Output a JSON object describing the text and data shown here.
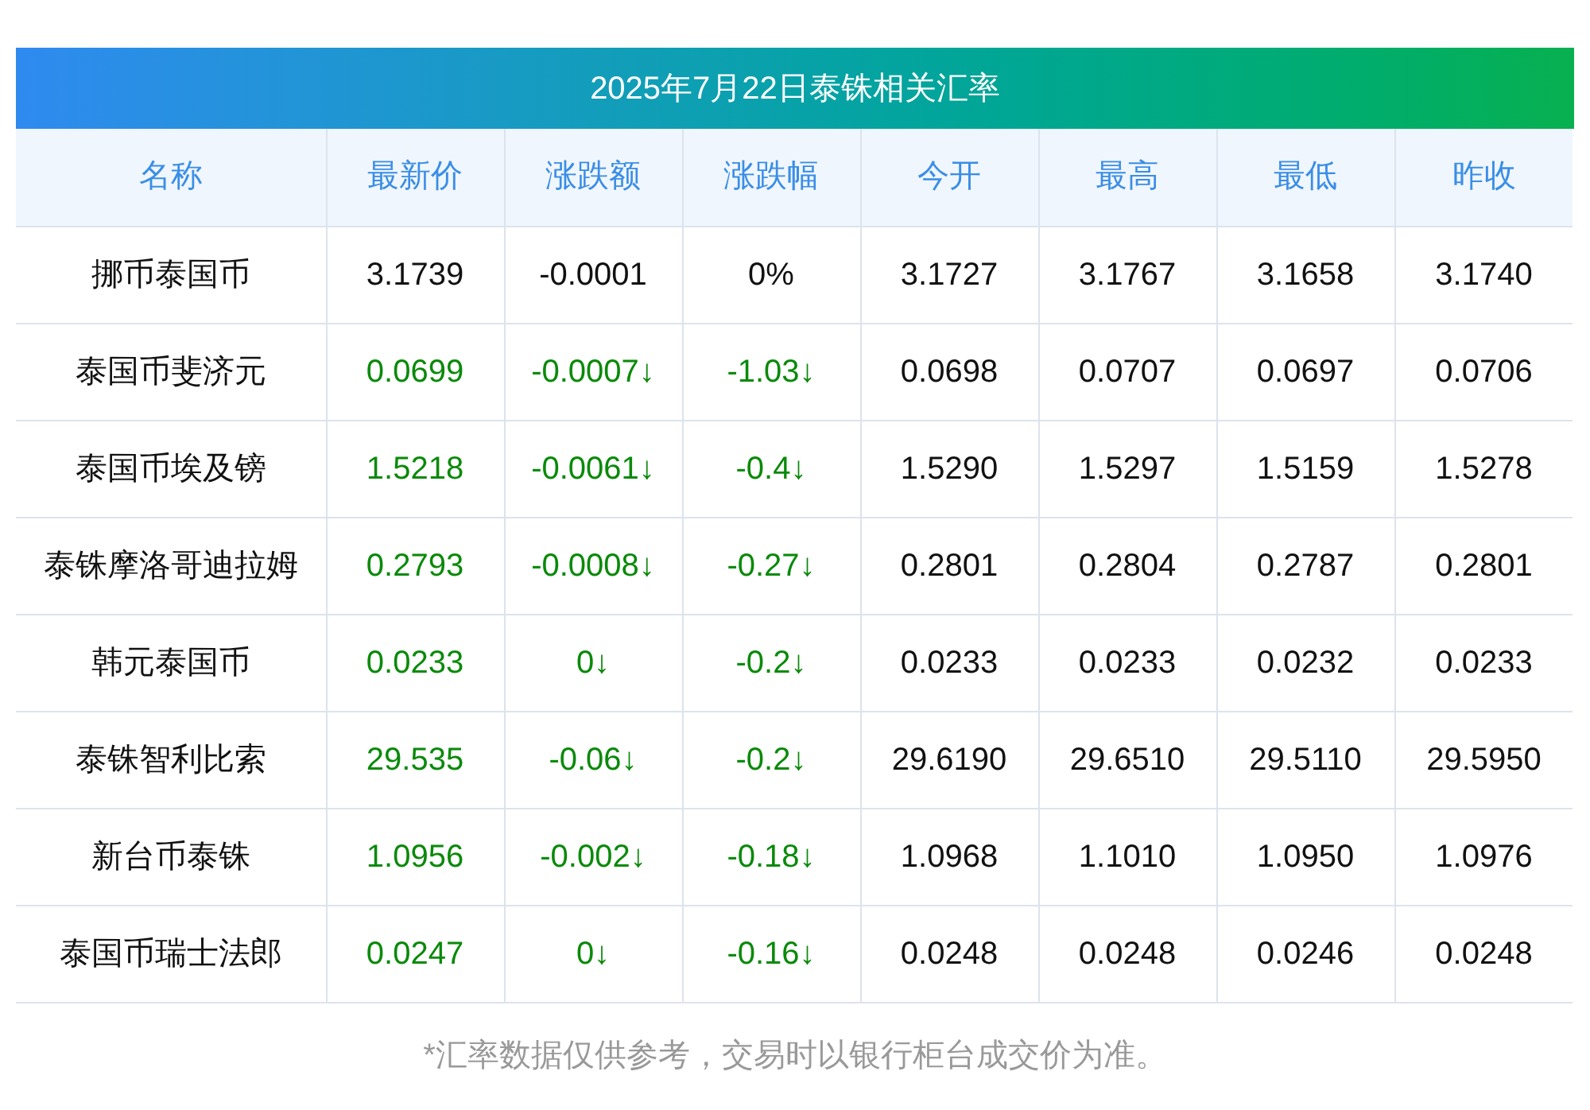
{
  "title": "2025年7月22日泰铢相关汇率",
  "table": {
    "columns": [
      "名称",
      "最新价",
      "涨跌额",
      "涨跌幅",
      "今开",
      "最高",
      "最低",
      "昨收"
    ],
    "rows": [
      {
        "falling": false,
        "cells": [
          "挪币泰国币",
          "3.1739",
          "-0.0001",
          "0%",
          "3.1727",
          "3.1767",
          "3.1658",
          "3.1740"
        ]
      },
      {
        "falling": true,
        "cells": [
          "泰国币斐济元",
          "0.0699",
          "-0.0007↓",
          "-1.03↓",
          "0.0698",
          "0.0707",
          "0.0697",
          "0.0706"
        ]
      },
      {
        "falling": true,
        "cells": [
          "泰国币埃及镑",
          "1.5218",
          "-0.0061↓",
          "-0.4↓",
          "1.5290",
          "1.5297",
          "1.5159",
          "1.5278"
        ]
      },
      {
        "falling": true,
        "cells": [
          "泰铢摩洛哥迪拉姆",
          "0.2793",
          "-0.0008↓",
          "-0.27↓",
          "0.2801",
          "0.2804",
          "0.2787",
          "0.2801"
        ]
      },
      {
        "falling": true,
        "cells": [
          "韩元泰国币",
          "0.0233",
          "0↓",
          "-0.2↓",
          "0.0233",
          "0.0233",
          "0.0232",
          "0.0233"
        ]
      },
      {
        "falling": true,
        "cells": [
          "泰铢智利比索",
          "29.535",
          "-0.06↓",
          "-0.2↓",
          "29.6190",
          "29.6510",
          "29.5110",
          "29.5950"
        ]
      },
      {
        "falling": true,
        "cells": [
          "新台币泰铢",
          "1.0956",
          "-0.002↓",
          "-0.18↓",
          "1.0968",
          "1.1010",
          "1.0950",
          "1.0976"
        ]
      },
      {
        "falling": true,
        "cells": [
          "泰国币瑞士法郎",
          "0.0247",
          "0↓",
          "-0.16↓",
          "0.0248",
          "0.0248",
          "0.0246",
          "0.0248"
        ]
      }
    ]
  },
  "footnote": "*汇率数据仅供参考，交易时以银行柜台成交价为准。"
}
